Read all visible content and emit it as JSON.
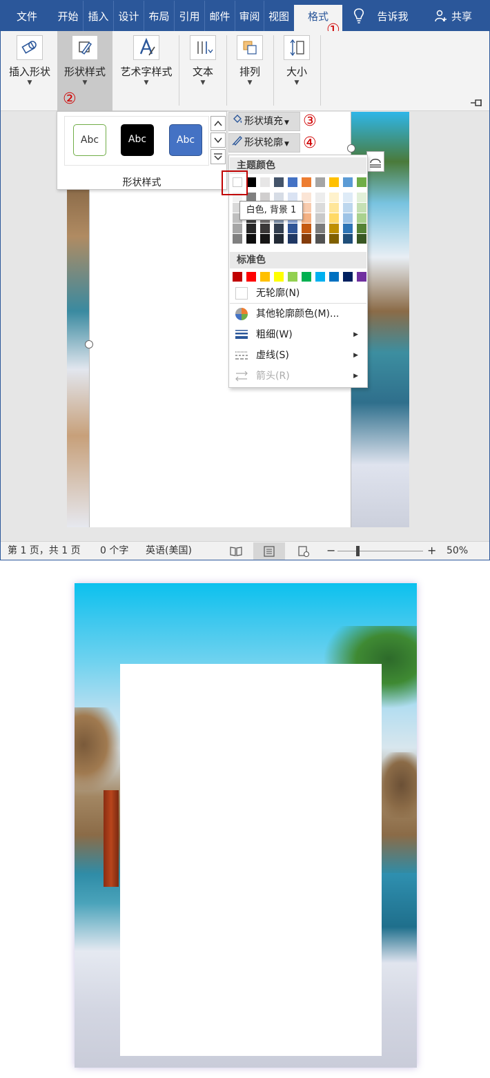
{
  "ribbon_tabs": [
    "文件",
    "开始",
    "插入",
    "设计",
    "布局",
    "引用",
    "邮件",
    "审阅",
    "视图",
    "格式"
  ],
  "tell_me": "告诉我",
  "share": "共享",
  "step_numbers": [
    "①",
    "②",
    "③",
    "④"
  ],
  "ribbon_groups": [
    "插入形状",
    "形状样式",
    "艺术字样式",
    "文本",
    "排列",
    "大小"
  ],
  "style_gallery": {
    "samples": [
      "Abc",
      "Abc",
      "Abc"
    ],
    "group_label": "形状样式"
  },
  "shape_fill": "形状填充",
  "shape_outline": "形状轮廓",
  "outline_menu": {
    "theme_colors_label": "主题颜色",
    "standard_colors_label": "标准色",
    "no_outline": "无轮廓(N)",
    "more_colors": "其他轮廓颜色(M)...",
    "weight": "粗细(W)",
    "dashes": "虚线(S)",
    "arrows": "箭头(R)",
    "tooltip": "白色, 背景 1",
    "theme_row": [
      "#ffffff",
      "#000000",
      "#e7e6e6",
      "#44546a",
      "#4472c4",
      "#ed7d31",
      "#a5a5a5",
      "#ffc000",
      "#5b9bd5",
      "#70ad47"
    ],
    "theme_shades": [
      [
        "#f2f2f2",
        "#7f7f7f",
        "#d0cece",
        "#d6dce5",
        "#dae3f3",
        "#fbe5d6",
        "#ededed",
        "#fff2cc",
        "#deebf7",
        "#e2f0d9"
      ],
      [
        "#d9d9d9",
        "#595959",
        "#aeabab",
        "#adb9ca",
        "#b4c7e7",
        "#f8cbad",
        "#dbdbdb",
        "#ffe699",
        "#bdd7ee",
        "#c5e0b4"
      ],
      [
        "#bfbfbf",
        "#404040",
        "#757171",
        "#8497b0",
        "#8faadc",
        "#f4b183",
        "#c9c9c9",
        "#ffd966",
        "#9dc3e6",
        "#a9d18e"
      ],
      [
        "#a6a6a6",
        "#262626",
        "#3b3838",
        "#333f50",
        "#2f5597",
        "#c55a11",
        "#7b7b7b",
        "#bf9000",
        "#2e75b6",
        "#548235"
      ],
      [
        "#808080",
        "#0d0d0d",
        "#171616",
        "#222a35",
        "#203864",
        "#843c0c",
        "#525252",
        "#806000",
        "#1f4e79",
        "#385723"
      ]
    ],
    "standard_row": [
      "#c00000",
      "#ff0000",
      "#ffc000",
      "#ffff00",
      "#92d050",
      "#00b050",
      "#00b0f0",
      "#0070c0",
      "#002060",
      "#7030a0"
    ]
  },
  "status_bar": {
    "page": "第 1 页，共 1 页",
    "words": "0 个字",
    "language": "英语(美国)",
    "zoom": "50%"
  }
}
